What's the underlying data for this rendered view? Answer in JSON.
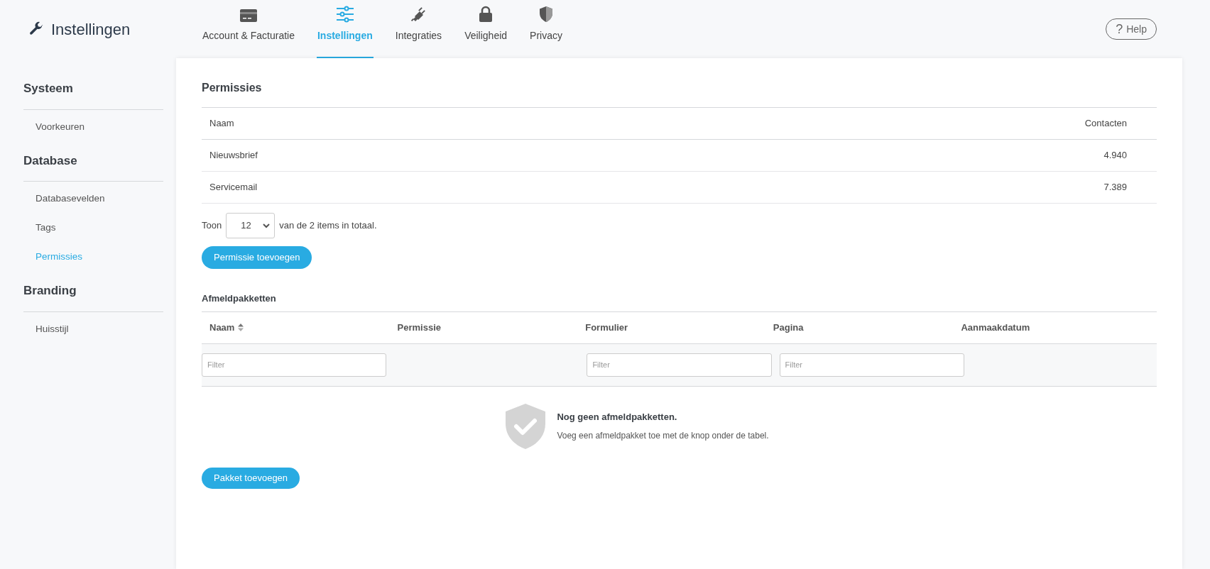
{
  "header": {
    "title": "Instellingen"
  },
  "tabs": [
    {
      "label": "Account & Facturatie",
      "kind": "card",
      "selected": false
    },
    {
      "label": "Instellingen",
      "kind": "sliders",
      "selected": true
    },
    {
      "label": "Integraties",
      "kind": "plug",
      "selected": false
    },
    {
      "label": "Veiligheid",
      "kind": "lock",
      "selected": false
    },
    {
      "label": "Privacy",
      "kind": "shield",
      "selected": false
    }
  ],
  "help_button": {
    "icon_text": "?",
    "label": "Help"
  },
  "sidebar": {
    "sections": [
      {
        "title": "Systeem",
        "items": [
          {
            "label": "Voorkeuren",
            "selected": false
          }
        ]
      },
      {
        "title": "Database",
        "items": [
          {
            "label": "Databasevelden",
            "selected": false
          },
          {
            "label": "Tags",
            "selected": false
          },
          {
            "label": "Permissies",
            "selected": true
          }
        ]
      },
      {
        "title": "Branding",
        "items": [
          {
            "label": "Huisstijl",
            "selected": false
          }
        ]
      }
    ]
  },
  "permissions": {
    "title": "Permissies",
    "columns": [
      "Naam",
      "Contacten"
    ],
    "rows": [
      [
        "Nieuwsbrief",
        "4.940"
      ],
      [
        "Servicemail",
        "7.389"
      ]
    ],
    "pagination": {
      "prefix": "Toon",
      "page_size": "12",
      "suffix": "van de 2 items in totaal."
    },
    "button": "Permissie toevoegen"
  },
  "packages": {
    "title": "Afmeldpakketten",
    "columns": [
      {
        "label": "Naam",
        "sortable": true
      },
      {
        "label": "Permissie",
        "sortable": false
      },
      {
        "label": "Formulier",
        "sortable": false
      },
      {
        "label": "Pagina",
        "sortable": false
      },
      {
        "label": "Aanmaakdatum",
        "sortable": false
      }
    ],
    "filters": [
      {
        "kind": "input",
        "placeholder": "Filter"
      },
      {
        "kind": "none"
      },
      {
        "kind": "input",
        "placeholder": "Filter"
      },
      {
        "kind": "input",
        "placeholder": "Filter"
      },
      {
        "kind": "none"
      }
    ],
    "empty_state": {
      "title": "Nog geen afmeldpakketten.",
      "text": "Voeg een afmeldpakket toe met de knop onder de tabel."
    },
    "button": "Pakket toevoegen"
  }
}
